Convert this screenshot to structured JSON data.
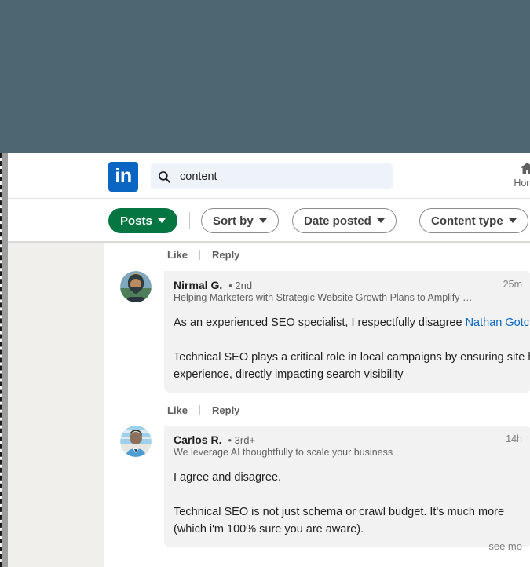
{
  "window": {
    "backdrop_color": "#4c6772"
  },
  "header": {
    "logo_text": "in",
    "logo_color": "#0a66c2",
    "search": {
      "icon": "search-icon",
      "value": "content",
      "placeholder": "Search"
    },
    "nav": [
      {
        "icon": "home-icon",
        "label": "Home"
      }
    ]
  },
  "filters": {
    "accent_color": "#057642",
    "pills": [
      {
        "label": "Posts",
        "style": "solid",
        "caret": true
      },
      {
        "label": "Sort by",
        "style": "outline",
        "caret": true
      },
      {
        "label": "Date posted",
        "style": "outline",
        "caret": true
      },
      {
        "label": "Content type",
        "style": "outline",
        "caret": true
      }
    ]
  },
  "actions": {
    "like_label": "Like",
    "reply_label": "Reply"
  },
  "comments": [
    {
      "name": "Nirmal G.",
      "degree": "• 2nd",
      "tagline": "Helping Marketers with Strategic Website Growth Plans to Amplify …",
      "time": "25m",
      "body_pre": "As an experienced SEO specialist, I respectfully disagree ",
      "mention": "Nathan Gotch",
      "body_post": ".\n\nTechnical SEO plays a critical role in local campaigns by ensuring site health and user experience, directly impacting search visibility",
      "like_label": "Like",
      "reply_label": "Reply",
      "avatar_colors": [
        "#6f8fa3",
        "#2f3b3f",
        "#c9a36b"
      ]
    },
    {
      "name": "Carlos R.",
      "degree": "• 3rd+",
      "tagline": "We leverage AI thoughtfully to scale your business",
      "time": "14h",
      "body_pre": "I agree and disagree.\n\nTechnical SEO is not just schema or crawl budget. It's much more\n(which i'm 100% sure you are aware).",
      "mention": "",
      "body_post": "",
      "see_more": "see mo",
      "avatar_colors": [
        "#9fd0ea",
        "#e8e6e1",
        "#3d4a52"
      ]
    }
  ]
}
